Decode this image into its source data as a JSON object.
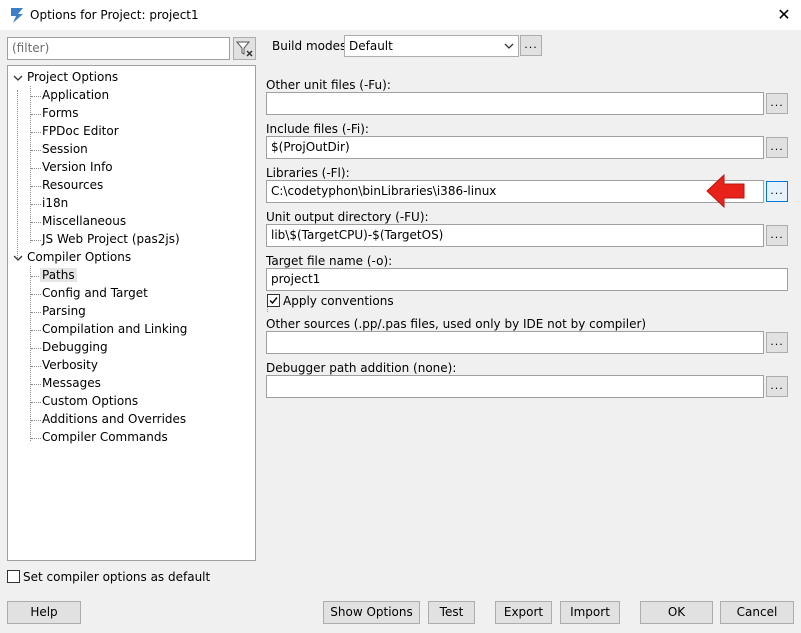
{
  "window": {
    "title": "Options for Project: project1"
  },
  "filter": {
    "placeholder": "(filter)"
  },
  "tree": {
    "groups": [
      {
        "label": "Project Options",
        "items": [
          "Application",
          "Forms",
          "FPDoc Editor",
          "Session",
          "Version Info",
          "Resources",
          "i18n",
          "Miscellaneous",
          "JS Web Project (pas2js)"
        ]
      },
      {
        "label": "Compiler Options",
        "items": [
          "Paths",
          "Config and Target",
          "Parsing",
          "Compilation and Linking",
          "Debugging",
          "Verbosity",
          "Messages",
          "Custom Options",
          "Additions and Overrides",
          "Compiler Commands"
        ]
      }
    ],
    "selected": "Paths"
  },
  "build_modes": {
    "label": "Build modes",
    "value": "Default",
    "more": "..."
  },
  "paths": {
    "other_unit_label": "Other unit files (-Fu):",
    "other_unit_value": "",
    "include_label": "Include files (-Fi):",
    "include_value": "$(ProjOutDir)",
    "libraries_label": "Libraries (-Fl):",
    "libraries_value": "C:\\codetyphon\\binLibraries\\i386-linux",
    "unit_output_label": "Unit output directory (-FU):",
    "unit_output_value": "lib\\$(TargetCPU)-$(TargetOS)",
    "target_label": "Target file name (-o):",
    "target_value": "project1",
    "apply_conventions": "Apply conventions",
    "apply_checked": true,
    "other_sources_label": "Other sources (.pp/.pas files, used only by IDE not by compiler)",
    "other_sources_value": "",
    "debugger_label": "Debugger path addition (none):",
    "debugger_value": "",
    "browse": "..."
  },
  "set_default": {
    "label": "Set compiler options as default",
    "checked": false
  },
  "buttons": {
    "help": "Help",
    "show_options": "Show Options",
    "test": "Test",
    "export": "Export",
    "import": "Import",
    "ok": "OK",
    "cancel": "Cancel"
  },
  "colors": {
    "arrow": "#e8221b",
    "focus": "#0078d7",
    "selection": "#e5e5e5"
  },
  "icons": {
    "app": "codetyphon-logo-icon",
    "filter": "filter-clear-icon",
    "close": "close-icon",
    "dropdown": "chevron-down-icon"
  }
}
